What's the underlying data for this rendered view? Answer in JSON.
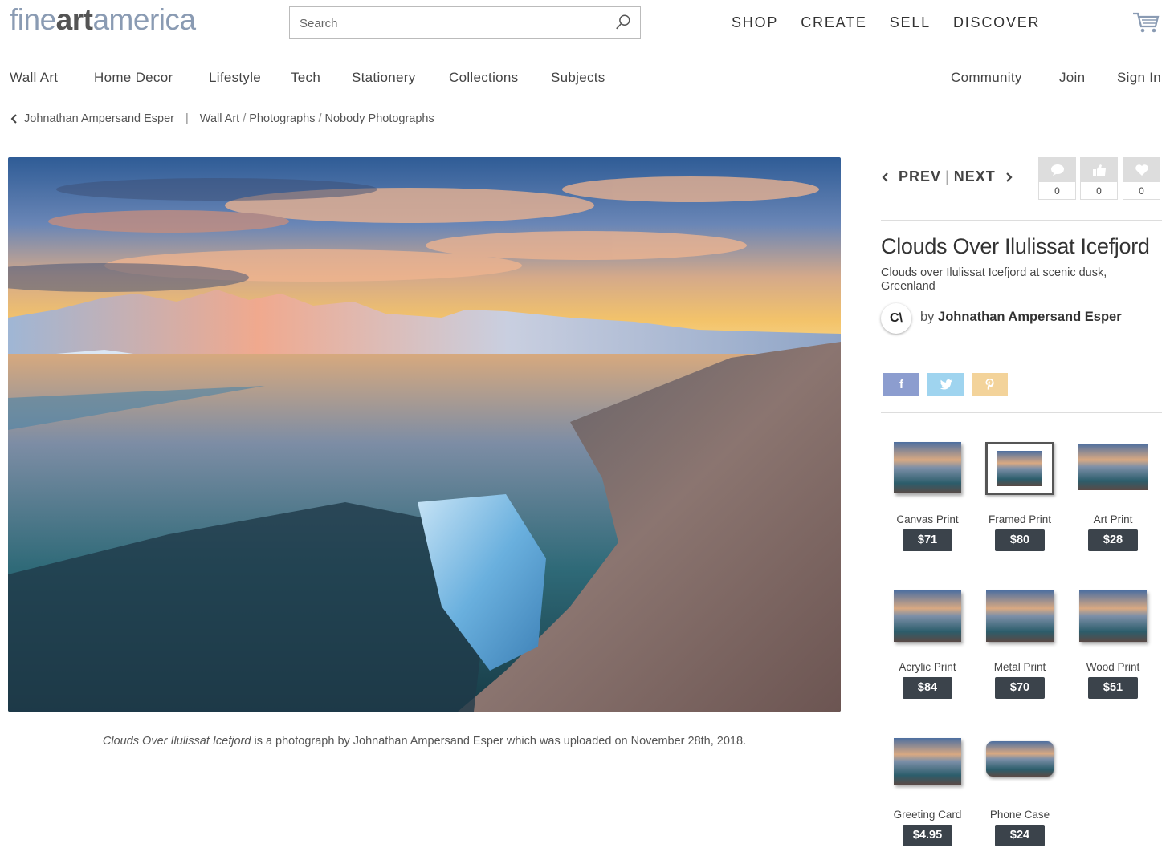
{
  "header": {
    "logo_part1": "fine",
    "logo_part2": "art",
    "logo_part3": "america",
    "search_placeholder": "Search",
    "nav": [
      "SHOP",
      "CREATE",
      "SELL",
      "DISCOVER"
    ]
  },
  "subnav": {
    "left": [
      "Wall Art",
      "Home Decor",
      "Lifestyle",
      "Tech",
      "Stationery",
      "Collections",
      "Subjects"
    ],
    "right": [
      "Community",
      "Join",
      "Sign In"
    ]
  },
  "breadcrumb": {
    "artist": "Johnathan Ampersand Esper",
    "separator": "|",
    "path": [
      "Wall Art",
      "Photographs",
      "Nobody Photographs"
    ]
  },
  "artwork": {
    "title": "Clouds Over Ilulissat Icefjord",
    "description": "Clouds over Ilulissat Icefjord at scenic dusk, Greenland",
    "by": "by",
    "artist": "Johnathan Ampersand Esper",
    "avatar_text": "C\\",
    "caption_title": "Clouds Over Ilulissat Icefjord",
    "caption_rest": " is a photograph by Johnathan Ampersand Esper which was uploaded on November 28th, 2018."
  },
  "navigation": {
    "prev": "PREV",
    "pipe": "|",
    "next": "NEXT"
  },
  "stats": {
    "comments": "0",
    "likes": "0",
    "favorites": "0"
  },
  "share": {
    "facebook": "f",
    "twitter_color": "#9fd4ef",
    "facebook_color": "#8c9dcf",
    "pinterest_color": "#f3d39a"
  },
  "products": [
    {
      "label": "Canvas Print",
      "price": "$71"
    },
    {
      "label": "Framed Print",
      "price": "$80"
    },
    {
      "label": "Art Print",
      "price": "$28"
    },
    {
      "label": "Acrylic Print",
      "price": "$84"
    },
    {
      "label": "Metal Print",
      "price": "$70"
    },
    {
      "label": "Wood Print",
      "price": "$51"
    },
    {
      "label": "Greeting Card",
      "price": "$4.95"
    },
    {
      "label": "Phone Case",
      "price": "$24"
    }
  ],
  "colors": {
    "logo_light": "#8a9bb3",
    "price_bg": "#3b434b"
  }
}
